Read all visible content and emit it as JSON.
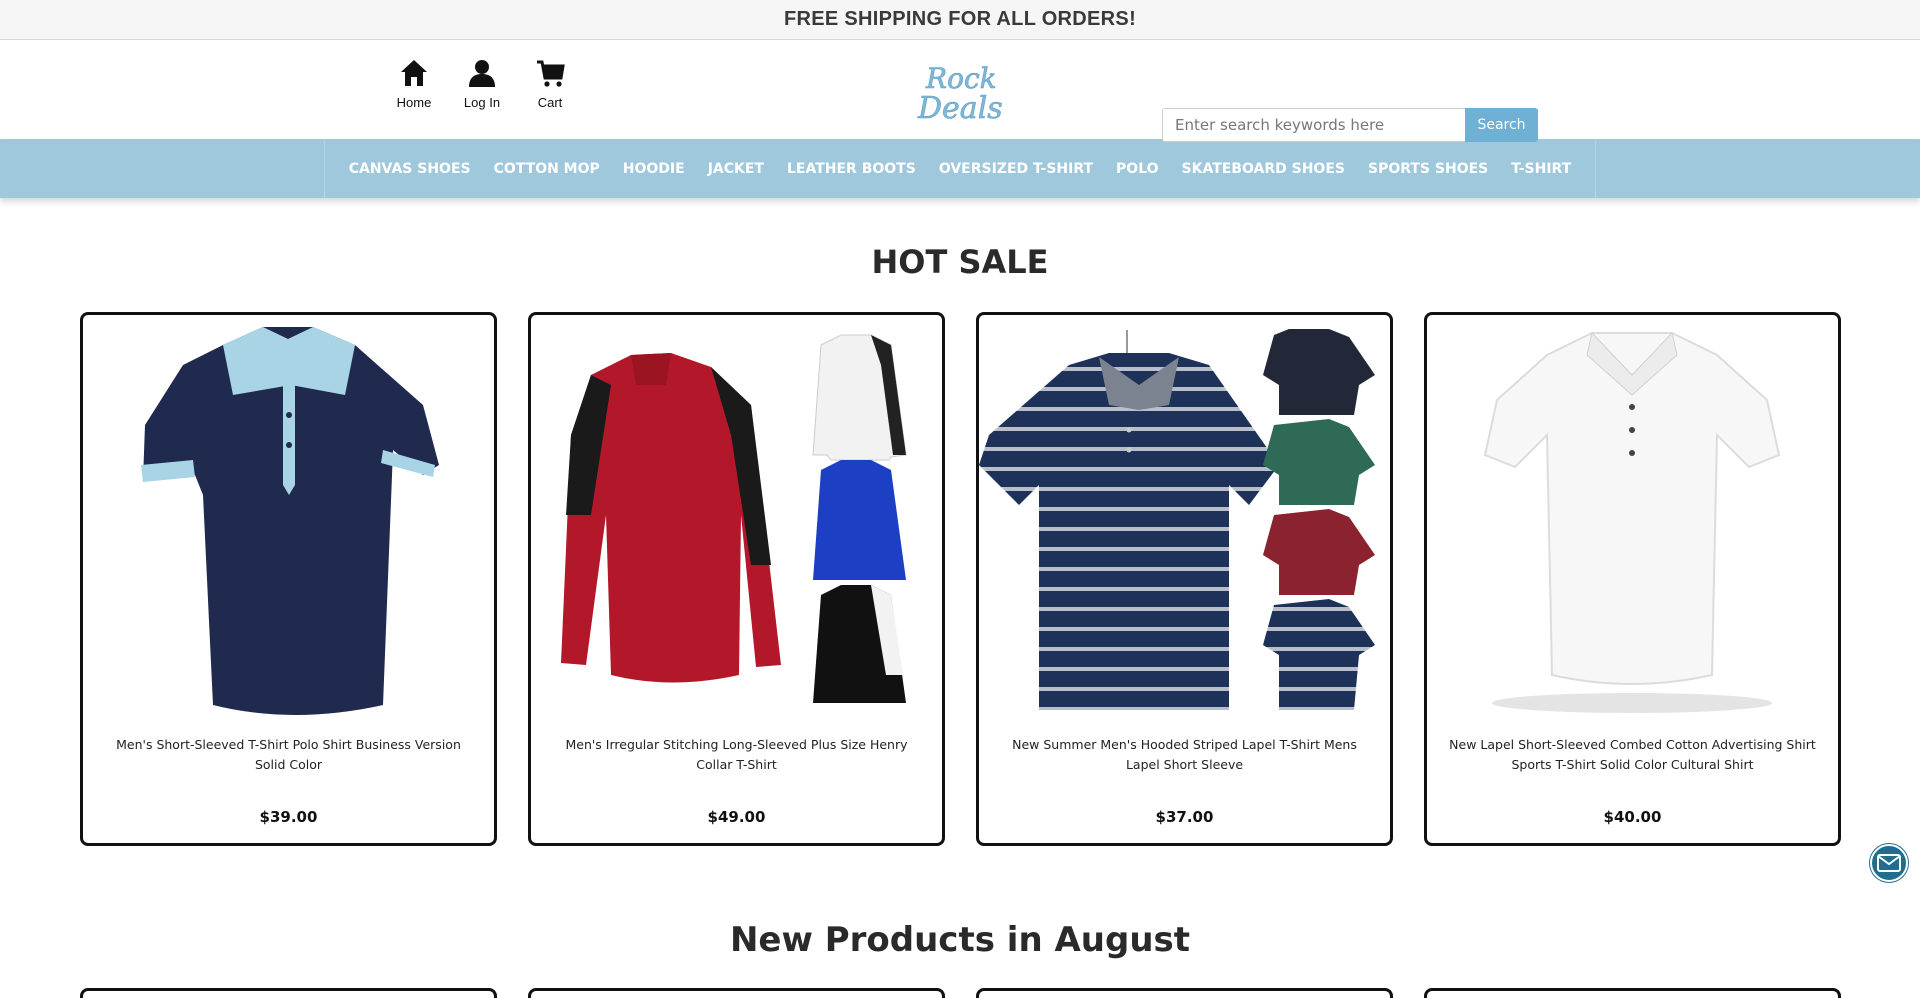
{
  "announcement": "FREE SHIPPING FOR ALL ORDERS!",
  "quick_nav": [
    {
      "label": "Home",
      "icon": "home-icon"
    },
    {
      "label": "Log In",
      "icon": "user-icon"
    },
    {
      "label": "Cart",
      "icon": "cart-icon"
    }
  ],
  "logo": {
    "line1": "Rock",
    "line2": "Deals",
    "color": "#7fb8d8"
  },
  "search": {
    "placeholder": "Enter search keywords here",
    "button_label": "Search"
  },
  "categories": [
    "CANVAS SHOES",
    "COTTON MOP",
    "HOODIE",
    "JACKET",
    "LEATHER BOOTS",
    "OVERSIZED T-SHIRT",
    "POLO",
    "SKATEBOARD SHOES",
    "SPORTS SHOES",
    "T-SHIRT"
  ],
  "hot_sale": {
    "title": "HOT SALE",
    "products": [
      {
        "name": "Men's Short-Sleeved T-Shirt Polo Shirt Business Version Solid Color",
        "price": "$39.00"
      },
      {
        "name": "Men's Irregular Stitching Long-Sleeved Plus Size Henry Collar T-Shirt",
        "price": "$49.00"
      },
      {
        "name": "New Summer Men's Hooded Striped Lapel T-Shirt Mens Lapel Short Sleeve",
        "price": "$37.00"
      },
      {
        "name": "New Lapel Short-Sleeved Combed Cotton Advertising Shirt Sports T-Shirt Solid Color Cultural Shirt",
        "price": "$40.00"
      }
    ]
  },
  "new_products": {
    "title": "New Products in August"
  },
  "colors": {
    "accent": "#6fb1d4",
    "nav_bg": "#9fc8dc",
    "mail_button": "#1f6e8e"
  }
}
